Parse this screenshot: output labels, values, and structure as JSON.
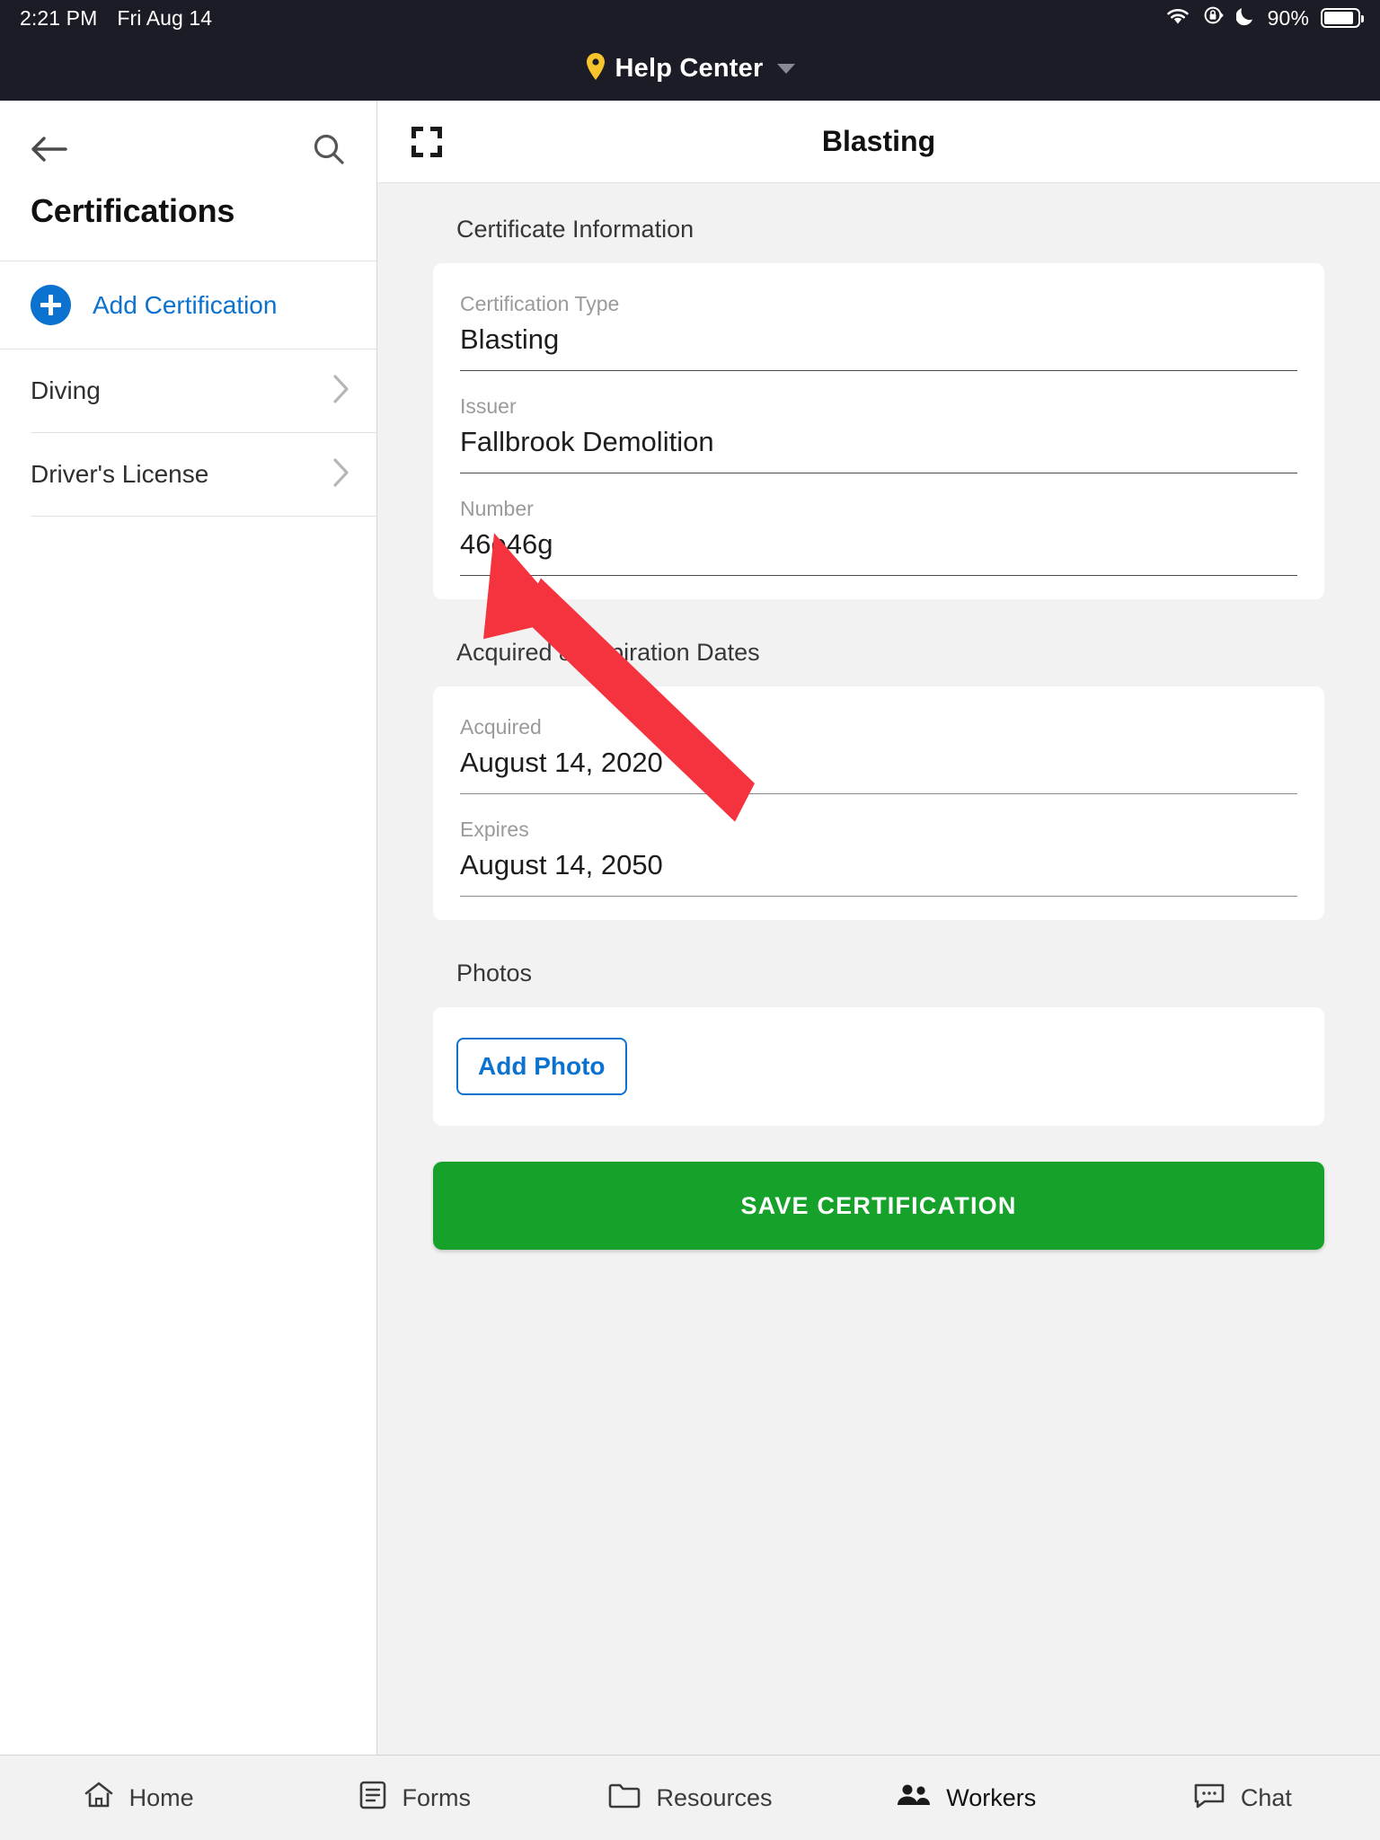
{
  "statusbar": {
    "time": "2:21 PM",
    "date": "Fri Aug 14",
    "wifi_icon": "wifi-icon",
    "rotation_lock_icon": "rotation-lock-icon",
    "do_not_disturb_icon": "moon-icon",
    "battery_percent": "90%",
    "battery_icon": "battery-icon"
  },
  "app_header": {
    "pin_icon": "location-pin-icon",
    "title": "Help Center",
    "caret_icon": "chevron-down-icon",
    "pin_color": "#f7c52b",
    "background": "#1c1c26"
  },
  "sidebar": {
    "back_icon": "back-arrow-icon",
    "search_icon": "search-icon",
    "title": "Certifications",
    "add": {
      "icon": "plus-circle-icon",
      "label": "Add Certification"
    },
    "items": [
      {
        "label": "Diving",
        "chevron": "chevron-right-icon"
      },
      {
        "label": "Driver's License",
        "chevron": "chevron-right-icon"
      }
    ]
  },
  "detail": {
    "expand_icon": "fullscreen-expand-icon",
    "title": "Blasting",
    "sections": [
      {
        "title": "Certificate Information",
        "fields": [
          {
            "label": "Certification Type",
            "value": "Blasting"
          },
          {
            "label": "Issuer",
            "value": "Fallbrook Demolition"
          },
          {
            "label": "Number",
            "value": "46e46g"
          }
        ]
      },
      {
        "title": "Acquired & Expiration Dates",
        "fields": [
          {
            "label": "Acquired",
            "value": "August 14, 2020"
          },
          {
            "label": "Expires",
            "value": "August 14, 2050"
          }
        ]
      }
    ],
    "photos": {
      "title": "Photos",
      "add_photo_label": "Add Photo"
    },
    "save_label": "SAVE CERTIFICATION",
    "save_color": "#16a22a",
    "accent_color": "#0b72cf",
    "annotation_arrow_color": "#f5333f"
  },
  "tabbar": {
    "items": [
      {
        "label": "Home",
        "icon": "home-icon",
        "active": false
      },
      {
        "label": "Forms",
        "icon": "forms-icon",
        "active": false
      },
      {
        "label": "Resources",
        "icon": "folder-icon",
        "active": false
      },
      {
        "label": "Workers",
        "icon": "workers-icon",
        "active": true
      },
      {
        "label": "Chat",
        "icon": "chat-icon",
        "active": false
      }
    ]
  }
}
